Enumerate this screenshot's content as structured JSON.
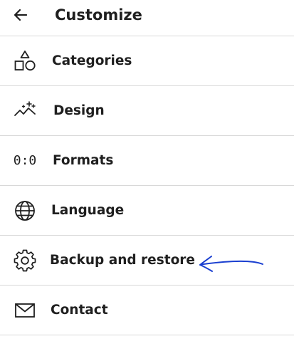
{
  "header": {
    "title": "Customize",
    "back_icon": "arrow-left-icon"
  },
  "menu": {
    "items": [
      {
        "label": "Categories",
        "icon": "shapes-icon"
      },
      {
        "label": "Design",
        "icon": "magic-wand-icon"
      },
      {
        "label": "Formats",
        "icon": "time-format-icon",
        "icon_text": "0:0"
      },
      {
        "label": "Language",
        "icon": "globe-icon"
      },
      {
        "label": "Backup and restore",
        "icon": "gear-icon"
      },
      {
        "label": "Contact",
        "icon": "envelope-icon"
      }
    ]
  },
  "annotation": {
    "type": "hand-drawn-arrow",
    "color": "#1a3fd0",
    "points_to": "Backup and restore"
  }
}
